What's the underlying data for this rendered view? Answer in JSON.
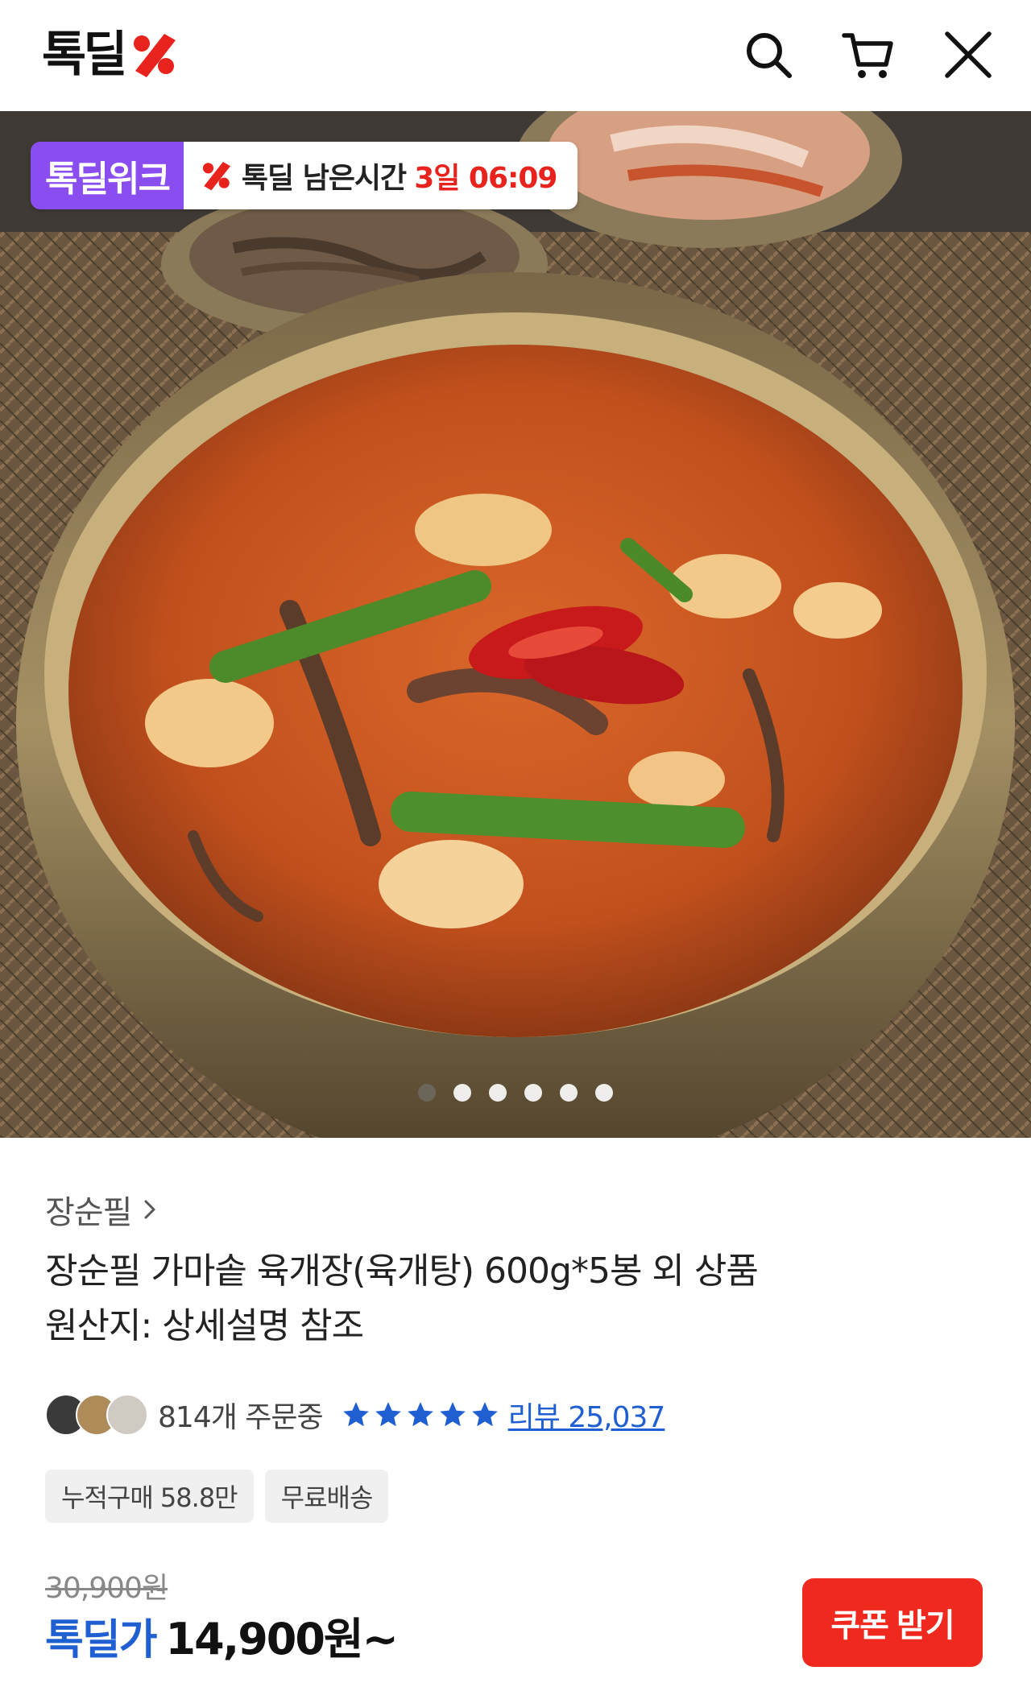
{
  "header": {
    "logo_text": "톡딜",
    "icons": [
      "search-icon",
      "cart-icon",
      "close-icon"
    ]
  },
  "hero": {
    "badge_left": "톡딜위크",
    "badge_prefix": "톡딜 남은시간",
    "badge_time": "3일 06:09",
    "slide_count": 6,
    "active_slide": 1
  },
  "product": {
    "brand": "장순필",
    "title_line1": "장순필 가마솥 육개장(육개탕) 600g*5봉 외 상품",
    "title_line2": "원산지: 상세설명 참조",
    "orders_text": "814개 주문중",
    "rating_stars": 5,
    "review_text": "리뷰 25,037",
    "chips": [
      "누적구매 58.8만",
      "무료배송"
    ],
    "original_price": "30,900원",
    "deal_label": "톡딜가",
    "deal_price": "14,900원~",
    "coupon_button": "쿠폰 받기"
  },
  "colors": {
    "accent_red": "#f0291f",
    "badge_purple": "#8a4df0",
    "link_blue": "#1f5fd1"
  }
}
